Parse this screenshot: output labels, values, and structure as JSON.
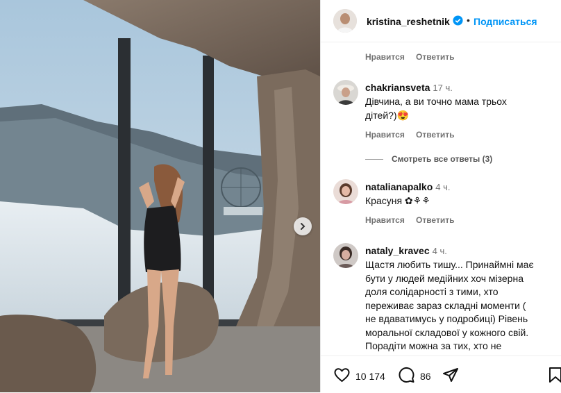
{
  "post": {
    "username": "kristina_reshetnik",
    "follow_label": "Подписаться",
    "separator": "•"
  },
  "top_actions": {
    "like_label": "Нравится",
    "reply_label": "Ответить"
  },
  "comments": [
    {
      "username": "chakriansveta",
      "time": "17 ч.",
      "text_line1": "Дівчина, а ви точно мама трьох",
      "text_line2": "дітей?)😍",
      "like_label": "Нравится",
      "reply_label": "Ответить",
      "view_replies": "Смотреть все ответы (3)"
    },
    {
      "username": "natalianapalko",
      "time": "4 ч.",
      "text": "Красуня ✿⚘⚘",
      "like_label": "Нравится",
      "reply_label": "Ответить"
    },
    {
      "username": "nataly_kravec",
      "time": "4 ч.",
      "lines": [
        "Щастя любить тишу... Принаймні має",
        "бути у людей медійних хоч мізерна",
        "доля солідарності з тими, хто",
        "переживає зараз складні моменти (",
        "не вдаватимусь у подробиці) Рівень",
        "моральної складової у кожного свій.",
        "Порадіти можна за тих, хто не"
      ]
    }
  ],
  "stats": {
    "likes": "10 174",
    "comments": "86"
  },
  "icons": [
    "verified-icon",
    "chevron-right-icon",
    "heart-icon",
    "comment-icon",
    "share-icon",
    "bookmark-icon"
  ],
  "colors": {
    "link_blue": "#0095f6",
    "meta_gray": "#737373"
  }
}
